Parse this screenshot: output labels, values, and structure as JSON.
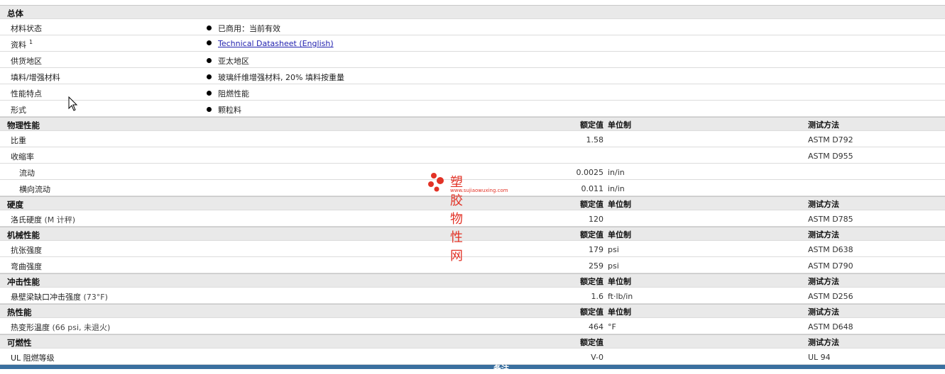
{
  "sections": {
    "general": {
      "title": "总体",
      "rows": [
        {
          "label": "材料状态",
          "value": "已商用：当前有效"
        },
        {
          "label": "资料",
          "sup": "1",
          "link": "Technical Datasheet (English)"
        },
        {
          "label": "供货地区",
          "value": "亚太地区"
        },
        {
          "label": "填料/增强材料",
          "value": "玻璃纤维增强材料, 20% 填料按重量"
        },
        {
          "label": "性能特点",
          "value": "阻燃性能"
        },
        {
          "label": "形式",
          "value": "颗粒料"
        }
      ]
    },
    "physical": {
      "title": "物理性能",
      "col_value": "额定值",
      "col_unit": "单位制",
      "col_test": "测试方法",
      "rows": [
        {
          "label": "比重",
          "value": "1.58",
          "unit": "",
          "test": "ASTM D792"
        },
        {
          "label": "收缩率",
          "value": "",
          "unit": "",
          "test": "ASTM D955"
        },
        {
          "label": "流动",
          "value": "0.0025",
          "unit": "in/in",
          "test": ""
        },
        {
          "label": "横向流动",
          "value": "0.011",
          "unit": "in/in",
          "test": ""
        }
      ]
    },
    "hardness": {
      "title": "硬度",
      "col_value": "额定值",
      "col_unit": "单位制",
      "col_test": "测试方法",
      "rows": [
        {
          "label": "洛氏硬度",
          "paren": "(M 计秤)",
          "value": "120",
          "unit": "",
          "test": "ASTM D785"
        }
      ]
    },
    "mechanical": {
      "title": "机械性能",
      "col_value": "额定值",
      "col_unit": "单位制",
      "col_test": "测试方法",
      "rows": [
        {
          "label": "抗张强度",
          "value": "179",
          "unit": "psi",
          "test": "ASTM D638"
        },
        {
          "label": "弯曲强度",
          "value": "259",
          "unit": "psi",
          "test": "ASTM D790"
        }
      ]
    },
    "impact": {
      "title": "冲击性能",
      "col_value": "额定值",
      "col_unit": "单位制",
      "col_test": "测试方法",
      "rows": [
        {
          "label": "悬壁梁缺口冲击强度",
          "paren": "(73°F)",
          "value": "1.6",
          "unit": "ft·lb/in",
          "test": "ASTM D256"
        }
      ]
    },
    "thermal": {
      "title": "热性能",
      "col_value": "额定值",
      "col_unit": "单位制",
      "col_test": "测试方法",
      "rows": [
        {
          "label": "热变形温度",
          "paren": "(66 psi, 未退火)",
          "value": "464",
          "unit": "°F",
          "test": "ASTM D648"
        }
      ]
    },
    "flammability": {
      "title": "可燃性",
      "col_value": "额定值",
      "col_test": "测试方法",
      "rows": [
        {
          "label": "UL 阻燃等级",
          "value": "V-0",
          "unit": "",
          "test": "UL 94"
        }
      ]
    }
  },
  "watermark": {
    "text": "塑胶物性网",
    "url": "www.sujiaowuxing.com"
  },
  "footer": {
    "label": "备注"
  },
  "colors": {
    "header_bg": "#e9e9e9",
    "link": "#2323b0",
    "watermark": "#e23226",
    "footer_bar": "#3a6f9f"
  }
}
